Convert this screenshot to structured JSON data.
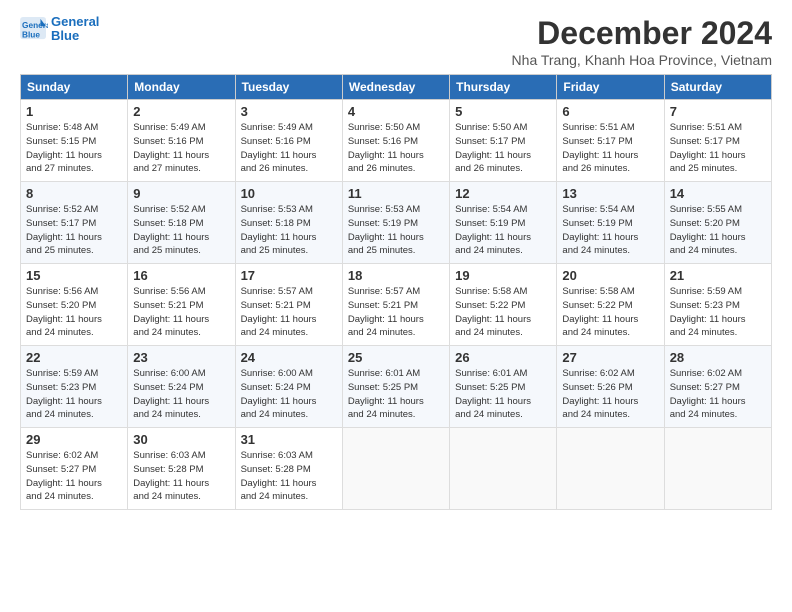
{
  "header": {
    "logo_line1": "General",
    "logo_line2": "Blue",
    "month": "December 2024",
    "location": "Nha Trang, Khanh Hoa Province, Vietnam"
  },
  "days_of_week": [
    "Sunday",
    "Monday",
    "Tuesday",
    "Wednesday",
    "Thursday",
    "Friday",
    "Saturday"
  ],
  "weeks": [
    [
      {
        "day": "1",
        "sunrise": "5:48 AM",
        "sunset": "5:15 PM",
        "daylight": "11 hours and 27 minutes."
      },
      {
        "day": "2",
        "sunrise": "5:49 AM",
        "sunset": "5:16 PM",
        "daylight": "11 hours and 27 minutes."
      },
      {
        "day": "3",
        "sunrise": "5:49 AM",
        "sunset": "5:16 PM",
        "daylight": "11 hours and 26 minutes."
      },
      {
        "day": "4",
        "sunrise": "5:50 AM",
        "sunset": "5:16 PM",
        "daylight": "11 hours and 26 minutes."
      },
      {
        "day": "5",
        "sunrise": "5:50 AM",
        "sunset": "5:17 PM",
        "daylight": "11 hours and 26 minutes."
      },
      {
        "day": "6",
        "sunrise": "5:51 AM",
        "sunset": "5:17 PM",
        "daylight": "11 hours and 26 minutes."
      },
      {
        "day": "7",
        "sunrise": "5:51 AM",
        "sunset": "5:17 PM",
        "daylight": "11 hours and 25 minutes."
      }
    ],
    [
      {
        "day": "8",
        "sunrise": "5:52 AM",
        "sunset": "5:17 PM",
        "daylight": "11 hours and 25 minutes."
      },
      {
        "day": "9",
        "sunrise": "5:52 AM",
        "sunset": "5:18 PM",
        "daylight": "11 hours and 25 minutes."
      },
      {
        "day": "10",
        "sunrise": "5:53 AM",
        "sunset": "5:18 PM",
        "daylight": "11 hours and 25 minutes."
      },
      {
        "day": "11",
        "sunrise": "5:53 AM",
        "sunset": "5:19 PM",
        "daylight": "11 hours and 25 minutes."
      },
      {
        "day": "12",
        "sunrise": "5:54 AM",
        "sunset": "5:19 PM",
        "daylight": "11 hours and 24 minutes."
      },
      {
        "day": "13",
        "sunrise": "5:54 AM",
        "sunset": "5:19 PM",
        "daylight": "11 hours and 24 minutes."
      },
      {
        "day": "14",
        "sunrise": "5:55 AM",
        "sunset": "5:20 PM",
        "daylight": "11 hours and 24 minutes."
      }
    ],
    [
      {
        "day": "15",
        "sunrise": "5:56 AM",
        "sunset": "5:20 PM",
        "daylight": "11 hours and 24 minutes."
      },
      {
        "day": "16",
        "sunrise": "5:56 AM",
        "sunset": "5:21 PM",
        "daylight": "11 hours and 24 minutes."
      },
      {
        "day": "17",
        "sunrise": "5:57 AM",
        "sunset": "5:21 PM",
        "daylight": "11 hours and 24 minutes."
      },
      {
        "day": "18",
        "sunrise": "5:57 AM",
        "sunset": "5:21 PM",
        "daylight": "11 hours and 24 minutes."
      },
      {
        "day": "19",
        "sunrise": "5:58 AM",
        "sunset": "5:22 PM",
        "daylight": "11 hours and 24 minutes."
      },
      {
        "day": "20",
        "sunrise": "5:58 AM",
        "sunset": "5:22 PM",
        "daylight": "11 hours and 24 minutes."
      },
      {
        "day": "21",
        "sunrise": "5:59 AM",
        "sunset": "5:23 PM",
        "daylight": "11 hours and 24 minutes."
      }
    ],
    [
      {
        "day": "22",
        "sunrise": "5:59 AM",
        "sunset": "5:23 PM",
        "daylight": "11 hours and 24 minutes."
      },
      {
        "day": "23",
        "sunrise": "6:00 AM",
        "sunset": "5:24 PM",
        "daylight": "11 hours and 24 minutes."
      },
      {
        "day": "24",
        "sunrise": "6:00 AM",
        "sunset": "5:24 PM",
        "daylight": "11 hours and 24 minutes."
      },
      {
        "day": "25",
        "sunrise": "6:01 AM",
        "sunset": "5:25 PM",
        "daylight": "11 hours and 24 minutes."
      },
      {
        "day": "26",
        "sunrise": "6:01 AM",
        "sunset": "5:25 PM",
        "daylight": "11 hours and 24 minutes."
      },
      {
        "day": "27",
        "sunrise": "6:02 AM",
        "sunset": "5:26 PM",
        "daylight": "11 hours and 24 minutes."
      },
      {
        "day": "28",
        "sunrise": "6:02 AM",
        "sunset": "5:27 PM",
        "daylight": "11 hours and 24 minutes."
      }
    ],
    [
      {
        "day": "29",
        "sunrise": "6:02 AM",
        "sunset": "5:27 PM",
        "daylight": "11 hours and 24 minutes."
      },
      {
        "day": "30",
        "sunrise": "6:03 AM",
        "sunset": "5:28 PM",
        "daylight": "11 hours and 24 minutes."
      },
      {
        "day": "31",
        "sunrise": "6:03 AM",
        "sunset": "5:28 PM",
        "daylight": "11 hours and 24 minutes."
      },
      null,
      null,
      null,
      null
    ]
  ],
  "labels": {
    "sunrise": "Sunrise:",
    "sunset": "Sunset:",
    "daylight": "Daylight:"
  }
}
